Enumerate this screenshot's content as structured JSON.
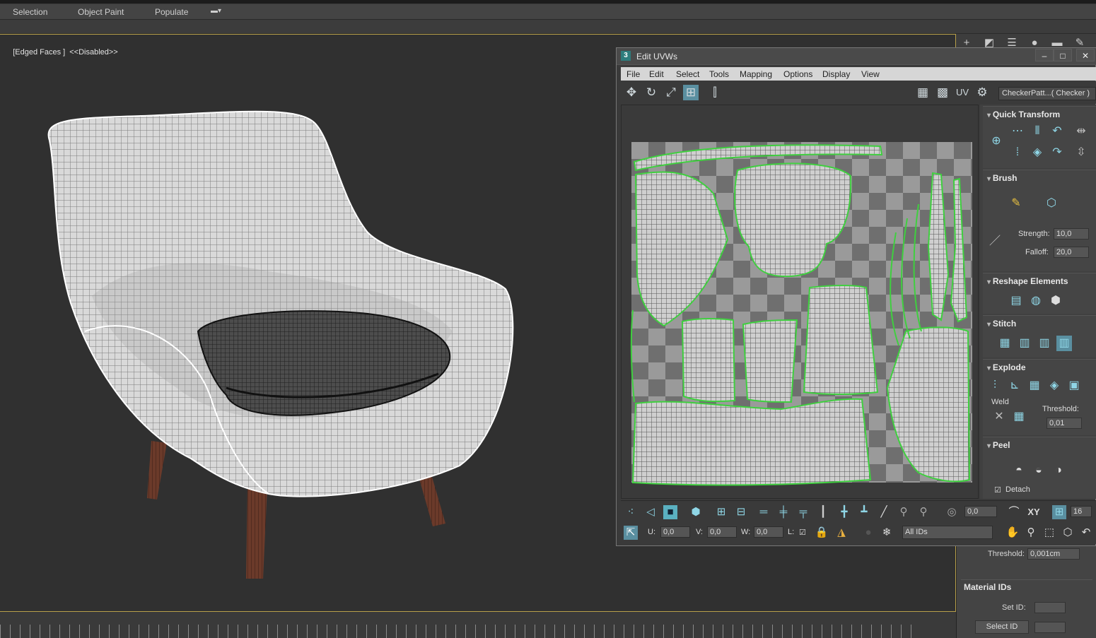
{
  "ribbon": {
    "tabs": [
      "Selection",
      "Object Paint",
      "Populate"
    ]
  },
  "viewport": {
    "label_mode": "[Edged Faces ]",
    "label_state": "<<Disabled>>"
  },
  "uv_window": {
    "title": "Edit UVWs",
    "app_icon_text": "3",
    "menu": [
      "File",
      "Edit",
      "Select",
      "Tools",
      "Mapping",
      "Options",
      "Display",
      "View"
    ],
    "uv_label": "UV",
    "checker_dropdown": "CheckerPatt...( Checker )",
    "panels": {
      "quick_transform": "Quick Transform",
      "brush": "Brush",
      "strength_label": "Strength:",
      "strength_value": "10,0",
      "falloff_label": "Falloff:",
      "falloff_value": "20,0",
      "reshape": "Reshape Elements",
      "stitch": "Stitch",
      "explode": "Explode",
      "weld_label": "Weld",
      "threshold_label": "Threshold:",
      "threshold_value": "0,01",
      "peel": "Peel",
      "detach_label": "Detach"
    },
    "bottom": {
      "spinner_value": "0,0",
      "xy_label": "XY",
      "grid_value": "16",
      "u_label": "U:",
      "u_value": "0,0",
      "v_label": "V:",
      "v_value": "0,0",
      "w_label": "W:",
      "w_value": "0,0",
      "l_label": "L:",
      "ids_dropdown": "All IDs"
    }
  },
  "command_panel": {
    "threshold_label": "Threshold:",
    "threshold_value": "0,001cm",
    "material_ids_title": "Material IDs",
    "set_id_label": "Set ID:",
    "select_id_button": "Select ID"
  },
  "colors": {
    "accent_uv_edge": "#3fcf3f",
    "viewport_border": "#b8a04a",
    "icon_accent": "#8fd6e6"
  }
}
